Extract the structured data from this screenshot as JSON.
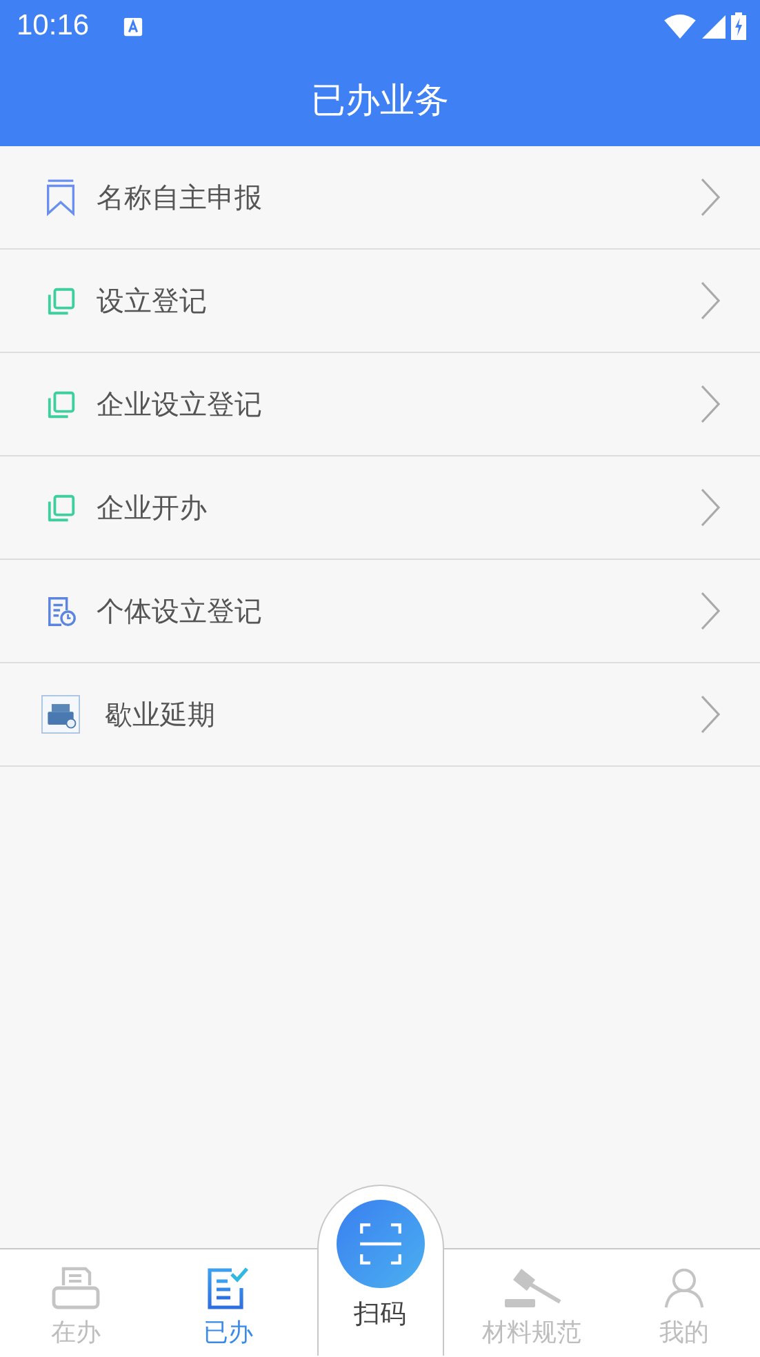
{
  "status_bar": {
    "time": "10:16"
  },
  "header": {
    "title": "已办业务"
  },
  "items": [
    {
      "label": "名称自主申报",
      "kind": "bookmark"
    },
    {
      "label": "设立登记",
      "kind": "copy"
    },
    {
      "label": "企业设立登记",
      "kind": "copy"
    },
    {
      "label": "企业开办",
      "kind": "copy"
    },
    {
      "label": "个体设立登记",
      "kind": "form"
    },
    {
      "label": "歇业延期",
      "kind": "stamp"
    }
  ],
  "scan_button": {
    "label": "扫码"
  },
  "tab_bar": [
    {
      "label": "在办",
      "kind": "printer",
      "selected": false
    },
    {
      "label": "已办",
      "kind": "checklist",
      "selected": true
    },
    {
      "label": "材料规范",
      "kind": "gavel",
      "selected": false
    },
    {
      "label": "我的",
      "kind": "person",
      "selected": false
    }
  ]
}
